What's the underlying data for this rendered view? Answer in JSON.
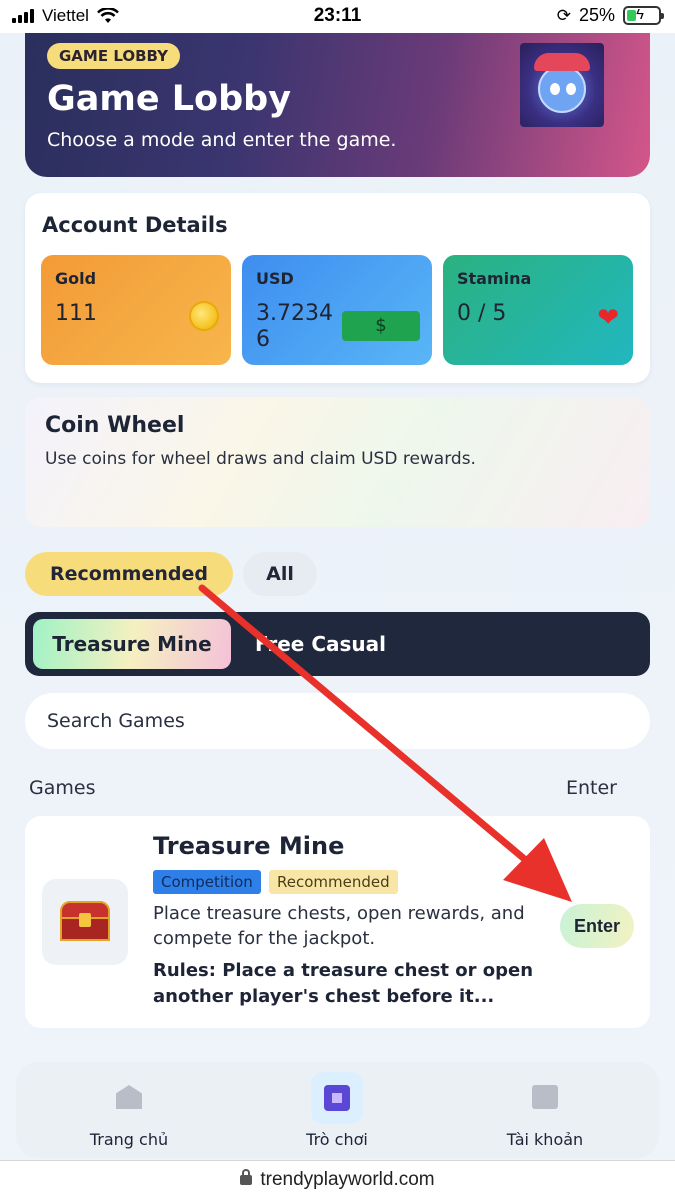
{
  "status_bar": {
    "carrier": "Viettel",
    "time": "23:11",
    "battery": "25%"
  },
  "header": {
    "badge": "GAME LOBBY",
    "title": "Game Lobby",
    "subtitle": "Choose a mode and enter the game."
  },
  "account": {
    "title": "Account Details",
    "gold": {
      "label": "Gold",
      "value": "111"
    },
    "usd": {
      "label": "USD",
      "value": "3.72346",
      "icon_text": "$"
    },
    "stamina": {
      "label": "Stamina",
      "value": "0 / 5"
    }
  },
  "coin_wheel": {
    "title": "Coin Wheel",
    "subtitle": "Use coins for wheel draws and claim USD rewards."
  },
  "filters": {
    "recommended": "Recommended",
    "all": "All"
  },
  "modes": {
    "active": "Treasure Mine",
    "other": "Free Casual"
  },
  "search": {
    "placeholder": "Search Games"
  },
  "list_header": {
    "games": "Games",
    "enter": "Enter"
  },
  "game": {
    "title": "Treasure Mine",
    "tags": [
      "Competition",
      "Recommended"
    ],
    "description": "Place treasure chests, open rewards, and compete for the jackpot.",
    "rules": "Rules: Place a treasure chest or open another player's chest before it...",
    "enter_label": "Enter"
  },
  "bottom_nav": [
    {
      "label": "Trang chủ",
      "icon": "home-icon"
    },
    {
      "label": "Trò chơi",
      "icon": "game-icon"
    },
    {
      "label": "Tài khoản",
      "icon": "account-icon"
    }
  ],
  "url": "trendyplayworld.com",
  "colors": {
    "accent_yellow": "#f7dc7c",
    "dark_navy": "#20283d",
    "arrow_red": "#e8312b"
  }
}
